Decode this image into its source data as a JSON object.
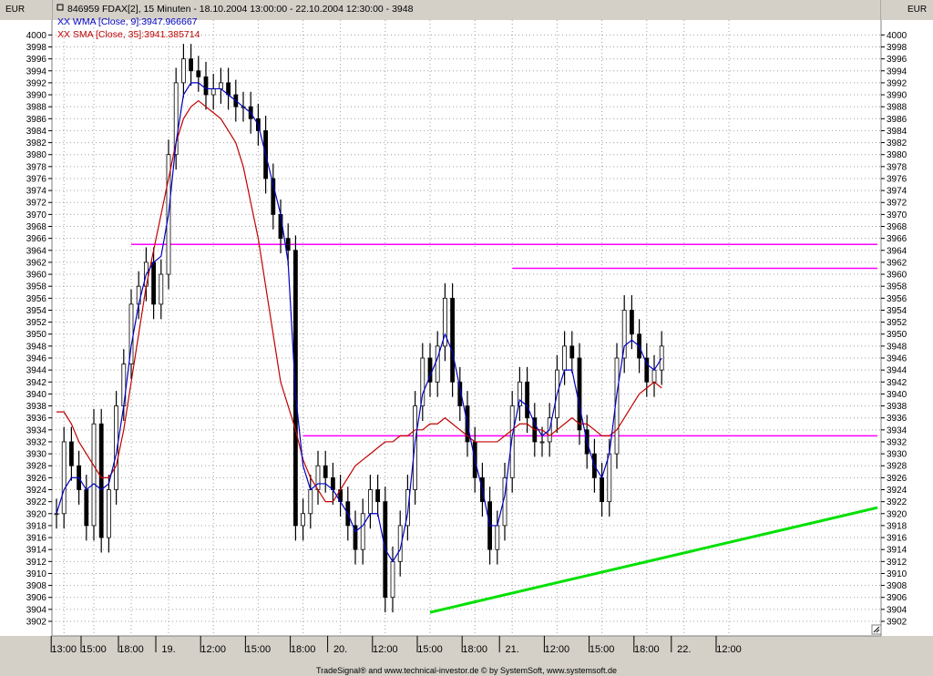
{
  "header": {
    "currency_left": "EUR",
    "currency_right": "EUR",
    "title": "846959  FDAX[2], 15 Minuten - 18.10.2004 13:00:00 - 22.10.2004 12:30:00 - 3948"
  },
  "legend": [
    {
      "label": "XX WMA [Close, 9]:3947.966667",
      "color": "#0000c0"
    },
    {
      "label": "XX SMA [Close, 35]:3941.385714",
      "color": "#c00000"
    }
  ],
  "footer": {
    "credit": "TradeSignal® and www.technical-investor.de © by  SystemSoft, www.systemsoft.de"
  },
  "chart_data": {
    "type": "line",
    "title": "846959  FDAX[2], 15 Minuten - 18.10.2004 13:00:00 - 22.10.2004 12:30:00 - 3948",
    "y_unit": "EUR",
    "ylim": [
      3900,
      4002
    ],
    "y_ticks": [
      3902,
      3904,
      3906,
      3908,
      3910,
      3912,
      3914,
      3916,
      3918,
      3920,
      3922,
      3924,
      3926,
      3928,
      3930,
      3932,
      3934,
      3936,
      3938,
      3940,
      3942,
      3944,
      3946,
      3948,
      3950,
      3952,
      3954,
      3956,
      3958,
      3960,
      3962,
      3964,
      3966,
      3968,
      3970,
      3972,
      3974,
      3976,
      3978,
      3980,
      3982,
      3984,
      3986,
      3988,
      3990,
      3992,
      3994,
      3996,
      3998,
      4000
    ],
    "x_tick_labels": [
      "13:00",
      "15:00",
      "18:00",
      "19.",
      "12:00",
      "15:00",
      "18:00",
      "20.",
      "12:00",
      "15:00",
      "18:00",
      "21.",
      "12:00",
      "15:00",
      "18:00",
      "22.",
      "12:00"
    ],
    "x_tick_positions": [
      1,
      5,
      10,
      15,
      21,
      27,
      33,
      38,
      44,
      50,
      56,
      61,
      67,
      73,
      79,
      84,
      90
    ],
    "x_range": [
      0,
      120
    ],
    "grid": true,
    "series": [
      {
        "name": "FDAX[2]",
        "kind": "price",
        "x": [
          0,
          1,
          2,
          3,
          4,
          5,
          6,
          7,
          8,
          9,
          10,
          11,
          12,
          13,
          14,
          15,
          16,
          17,
          18,
          19,
          20,
          21,
          22,
          23,
          24,
          25,
          26,
          27,
          28,
          29,
          30,
          31,
          32,
          33,
          34,
          35,
          36,
          37,
          38,
          39,
          40,
          41,
          42,
          43,
          44,
          45,
          46,
          47,
          48,
          49,
          50,
          51,
          52,
          53,
          54,
          55,
          56,
          57,
          58,
          59,
          60,
          61,
          62,
          63,
          64,
          65,
          66,
          67,
          68,
          69,
          70,
          71,
          72,
          73,
          74,
          75,
          76,
          77,
          78,
          79,
          80,
          81,
          82,
          83,
          84,
          85,
          86,
          87,
          88,
          89,
          90,
          91
        ],
        "close": [
          3920,
          3932,
          3928,
          3924,
          3918,
          3935,
          3916,
          3924,
          3938,
          3945,
          3955,
          3958,
          3962,
          3955,
          3960,
          3980,
          3992,
          3996,
          3994,
          3993,
          3990,
          3991,
          3992,
          3990,
          3988,
          3988,
          3986,
          3984,
          3976,
          3970,
          3966,
          3964,
          3918,
          3920,
          3924,
          3928,
          3926,
          3924,
          3922,
          3918,
          3914,
          3920,
          3924,
          3922,
          3906,
          3912,
          3918,
          3924,
          3938,
          3946,
          3942,
          3948,
          3956,
          3942,
          3938,
          3932,
          3926,
          3922,
          3914,
          3918,
          3926,
          3938,
          3942,
          3936,
          3932,
          3932,
          3936,
          3944,
          3948,
          3946,
          3934,
          3930,
          3926,
          3922,
          3930,
          3946,
          3954,
          3950,
          3946,
          3942,
          3944,
          3948
        ],
        "wma": [
          3920,
          3924,
          3926,
          3926,
          3924,
          3925,
          3924,
          3925,
          3930,
          3938,
          3948,
          3955,
          3960,
          3962,
          3963,
          3970,
          3982,
          3990,
          3992,
          3992,
          3991,
          3991,
          3991,
          3990,
          3989,
          3988,
          3987,
          3985,
          3980,
          3975,
          3970,
          3962,
          3940,
          3928,
          3924,
          3925,
          3925,
          3924,
          3922,
          3920,
          3917,
          3918,
          3920,
          3920,
          3914,
          3912,
          3914,
          3920,
          3932,
          3940,
          3943,
          3946,
          3950,
          3947,
          3941,
          3935,
          3929,
          3924,
          3918,
          3918,
          3923,
          3933,
          3939,
          3938,
          3935,
          3933,
          3934,
          3940,
          3944,
          3944,
          3938,
          3932,
          3928,
          3926,
          3930,
          3940,
          3948,
          3949,
          3948,
          3945,
          3944,
          3946
        ],
        "sma": [
          3937,
          3937,
          3935,
          3932,
          3930,
          3928,
          3926,
          3926,
          3928,
          3934,
          3942,
          3950,
          3958,
          3964,
          3970,
          3976,
          3982,
          3986,
          3988,
          3989,
          3988,
          3987,
          3986,
          3984,
          3982,
          3978,
          3972,
          3966,
          3958,
          3950,
          3942,
          3938,
          3934,
          3929,
          3926,
          3924,
          3922,
          3922,
          3924,
          3926,
          3928,
          3929,
          3930,
          3931,
          3932,
          3932,
          3933,
          3933,
          3934,
          3934,
          3935,
          3935,
          3936,
          3935,
          3934,
          3933,
          3932,
          3932,
          3932,
          3932,
          3933,
          3934,
          3935,
          3935,
          3934,
          3934,
          3933,
          3934,
          3935,
          3936,
          3935,
          3935,
          3934,
          3933,
          3933,
          3934,
          3936,
          3938,
          3940,
          3941,
          3942,
          3941
        ]
      },
      {
        "name": "XX WMA [Close, 9]",
        "last_value": 3947.966667,
        "color": "#0000c0"
      },
      {
        "name": "XX SMA [Close, 35]",
        "last_value": 3941.385714,
        "color": "#c00000"
      }
    ],
    "annotations": [
      {
        "kind": "hline",
        "y": 3965,
        "x_start": 10,
        "x_end": 120,
        "color": "#ff00ff"
      },
      {
        "kind": "hline",
        "y": 3961,
        "x_start": 61,
        "x_end": 120,
        "color": "#ff00ff"
      },
      {
        "kind": "hline",
        "y": 3933,
        "x_start": 33,
        "x_end": 120,
        "color": "#ff00ff"
      },
      {
        "kind": "trendline",
        "x1": 50,
        "y1": 3903.5,
        "x2": 120,
        "y2": 3921,
        "color": "#00e000"
      }
    ]
  }
}
